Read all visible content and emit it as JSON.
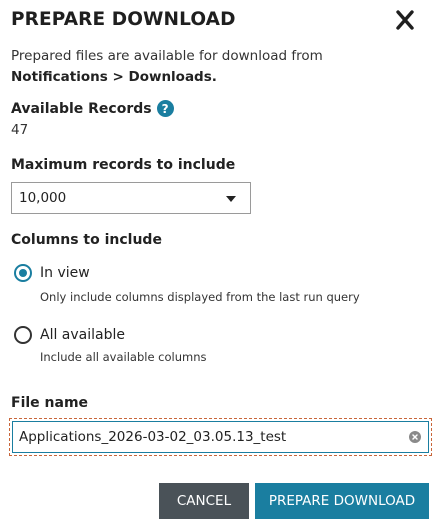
{
  "dialog": {
    "title": "PREPARE DOWNLOAD",
    "intro_line1": "Prepared files are available for download from",
    "intro_line2": "Notifications > Downloads."
  },
  "available_records": {
    "label": "Available Records",
    "help_glyph": "?",
    "count": "47"
  },
  "max_records": {
    "label": "Maximum records to include",
    "selected": "10,000"
  },
  "columns": {
    "label": "Columns to include",
    "options": [
      {
        "label": "In view",
        "description": "Only include columns displayed from the last run query",
        "checked": true
      },
      {
        "label": "All available",
        "description": "Include all available columns",
        "checked": false
      }
    ]
  },
  "file_name": {
    "label": "File name",
    "value": "Applications_2026-03-02_03.05.13_test"
  },
  "buttons": {
    "cancel": "CANCEL",
    "prepare": "PREPARE DOWNLOAD"
  },
  "colors": {
    "accent": "#1a7ea0",
    "cancel_bg": "#4a5258",
    "focus_outline": "#c8663a"
  },
  "icons": {
    "close": "close-icon",
    "help": "help-icon",
    "dropdown": "chevron-down-icon",
    "clear": "clear-icon"
  }
}
